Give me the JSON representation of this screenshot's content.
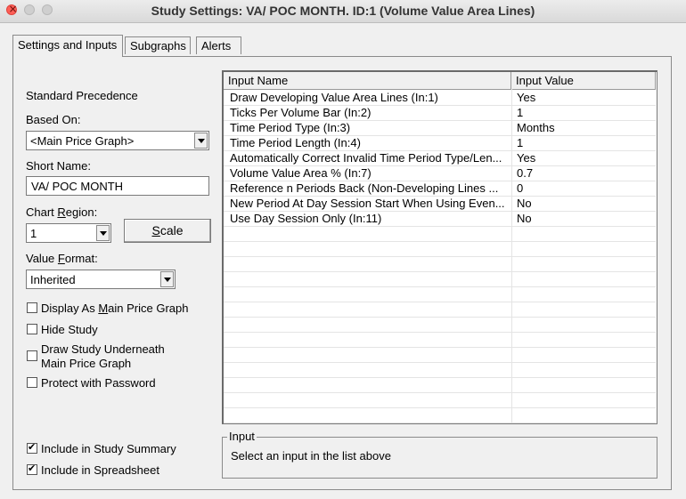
{
  "window": {
    "title": "Study Settings: VA/ POC MONTH. ID:1 (Volume Value Area Lines)"
  },
  "tabs": [
    {
      "label": "Settings and Inputs",
      "active": true
    },
    {
      "label": "Subgraphs",
      "active": false
    },
    {
      "label": "Alerts",
      "active": false
    }
  ],
  "left": {
    "standard_precedence": "Standard Precedence",
    "based_on_label": "Based On:",
    "based_on_value": "<Main Price Graph>",
    "short_name_label": "Short Name:",
    "short_name_value": "VA/ POC MONTH",
    "chart_region_label_pre": "Chart ",
    "chart_region_label_ul": "R",
    "chart_region_label_post": "egion:",
    "chart_region_value": "1",
    "scale_pre": "",
    "scale_ul": "S",
    "scale_post": "cale",
    "value_format_label_pre": "Value ",
    "value_format_label_ul": "F",
    "value_format_label_post": "ormat:",
    "value_format_value": "Inherited",
    "display_as_main_pre": "Display As ",
    "display_as_main_ul": "M",
    "display_as_main_post": "ain Price Graph",
    "hide_study": "Hide Study",
    "draw_underneath_line1": "Draw Study Underneath",
    "draw_underneath_line2": "Main Price Graph",
    "protect_password": "Protect with Password",
    "include_summary": "Include in Study Summary",
    "include_spreadsheet": "Include in Spreadsheet"
  },
  "inputs_table": {
    "headers": [
      "Input Name",
      "Input Value"
    ],
    "rows": [
      {
        "name": "Draw Developing Value Area Lines   (In:1)",
        "value": "Yes"
      },
      {
        "name": "Ticks Per Volume Bar   (In:2)",
        "value": "1"
      },
      {
        "name": "Time Period Type   (In:3)",
        "value": "Months"
      },
      {
        "name": "Time Period Length   (In:4)",
        "value": "1"
      },
      {
        "name": "Automatically Correct Invalid Time Period Type/Len...",
        "value": "Yes"
      },
      {
        "name": "Volume Value Area %   (In:7)",
        "value": "0.7"
      },
      {
        "name": "Reference n Periods Back (Non-Developing Lines ...",
        "value": "0"
      },
      {
        "name": "New Period At Day Session Start When Using Even...",
        "value": "No"
      },
      {
        "name": "Use Day Session Only   (In:11)",
        "value": "No"
      }
    ]
  },
  "input_box": {
    "legend": "Input",
    "message": "Select an input in the list above"
  }
}
